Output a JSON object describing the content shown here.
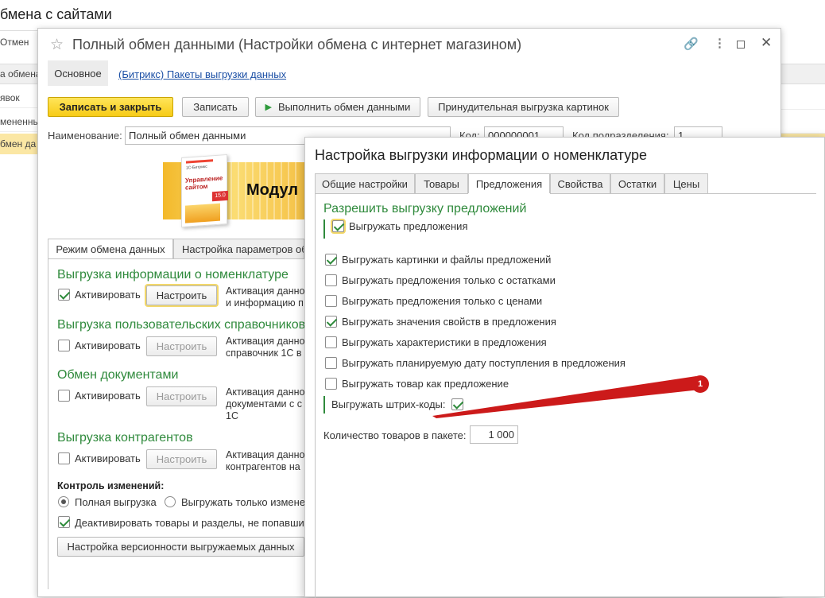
{
  "background": {
    "title": "бмена с сайтами",
    "rows": [
      "Отмен",
      "а обмена",
      "явок",
      "мененны",
      "бмен да"
    ]
  },
  "main_window": {
    "title": "Полный обмен данными (Настройки обмена с интернет магазином)",
    "nav": {
      "main": "Основное",
      "link": "(Битрикс) Пакеты выгрузки данных"
    },
    "toolbar": {
      "save_close": "Записать и закрыть",
      "save": "Записать",
      "run_exchange": "Выполнить обмен данными",
      "force_images": "Принудительная выгрузка картинок"
    },
    "name_label": "Наименование:",
    "name_value": "Полный обмен данными",
    "code_label": "Код:",
    "code_value": "000000001",
    "dept_label": "Код подразделения:",
    "dept_value": "1",
    "banner": {
      "text": "Модул",
      "version": "15.0",
      "box_text": "Управление сайтом",
      "brand": "1С-Битрикс"
    },
    "tabs": [
      "Режим обмена данных",
      "Настройка параметров об"
    ],
    "sections": [
      {
        "title": "Выгрузка информации о номенклатуре",
        "activate": "Активировать",
        "checked": true,
        "button": "Настроить",
        "enabled": true,
        "desc": [
          "Активация данно",
          "и информацию п"
        ]
      },
      {
        "title": "Выгрузка пользовательских справочников",
        "activate": "Активировать",
        "checked": false,
        "button": "Настроить",
        "enabled": false,
        "desc": [
          "Активация данно",
          "справочник 1С в"
        ]
      },
      {
        "title": "Обмен документами",
        "activate": "Активировать",
        "checked": false,
        "button": "Настроить",
        "enabled": false,
        "desc": [
          "Активация данно",
          "документами с с",
          "1С"
        ]
      },
      {
        "title": "Выгрузка контрагентов",
        "activate": "Активировать",
        "checked": false,
        "button": "Настроить",
        "enabled": false,
        "desc": [
          "Активация данно",
          "контрагентов на"
        ]
      }
    ],
    "change_control": {
      "label": "Контроль изменений:",
      "full": "Полная выгрузка",
      "changed_only": "Выгружать только измене",
      "deactivate": "Деактивировать товары и разделы, не попавшие",
      "versioning_button": "Настройка версионности выгружаемых данных"
    }
  },
  "dialog": {
    "title": "Настройка выгрузки информации о номенклатуре",
    "tabs": [
      "Общие настройки",
      "Товары",
      "Предложения",
      "Свойства",
      "Остатки",
      "Цены"
    ],
    "active_tab": "Предложения",
    "group_title": "Разрешить выгрузку предложений",
    "export_offers": "Выгружать предложения",
    "options": [
      {
        "label": "Выгружать картинки и файлы предложений",
        "checked": true
      },
      {
        "label": "Выгружать предложения только с остатками",
        "checked": false
      },
      {
        "label": "Выгружать предложения только с ценами",
        "checked": false
      },
      {
        "label": "Выгружать значения свойств в предложения",
        "checked": true
      },
      {
        "label": "Выгружать характеристики в предложения",
        "checked": false
      },
      {
        "label": "Выгружать планируемую дату поступления в предложения",
        "checked": false
      },
      {
        "label": "Выгружать товар как предложение",
        "checked": false
      }
    ],
    "barcodes_label": "Выгружать штрих-коды:",
    "barcodes_checked": true,
    "batch_label": "Количество товаров в пакете:",
    "batch_value": "1 000",
    "marker_number": "1",
    "colors": {
      "accent_green": "#2f8a3c",
      "marker_red": "#cc1a1a",
      "primary_yellow": "#f7cb17"
    }
  }
}
